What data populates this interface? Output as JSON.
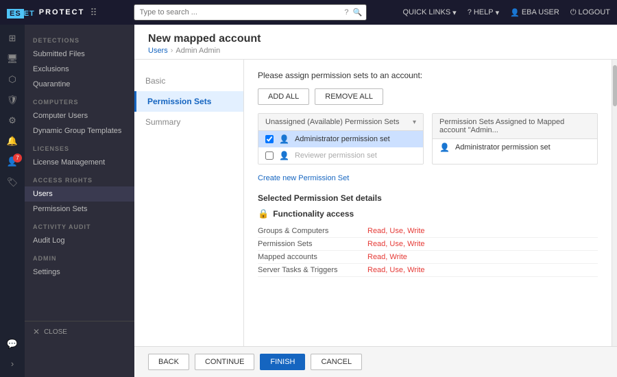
{
  "topbar": {
    "logo": "ESET",
    "product": "PROTECT",
    "search_placeholder": "Type to search ...",
    "quick_links": "QUICK LINKS",
    "help": "HELP",
    "user": "EBA USER",
    "logout": "LOGOUT"
  },
  "sidebar_icons": [
    {
      "name": "dashboard-icon",
      "symbol": "⊞",
      "active": false
    },
    {
      "name": "computers-icon",
      "symbol": "🖥",
      "active": false
    },
    {
      "name": "share-icon",
      "symbol": "⬡",
      "active": false
    },
    {
      "name": "shield-icon",
      "symbol": "🛡",
      "active": false
    },
    {
      "name": "gear-icon",
      "symbol": "⚙",
      "active": false
    },
    {
      "name": "bell-icon",
      "symbol": "🔔",
      "active": false
    },
    {
      "name": "users-icon",
      "symbol": "👤",
      "active": true,
      "badge": "7"
    },
    {
      "name": "tag-icon",
      "symbol": "🏷",
      "active": false
    },
    {
      "name": "more-icon",
      "symbol": "···",
      "active": false
    }
  ],
  "sidebar_nav": {
    "sections": [
      {
        "title": "DETECTIONS",
        "items": [
          {
            "label": "Submitted Files",
            "active": false
          },
          {
            "label": "Exclusions",
            "active": false
          },
          {
            "label": "Quarantine",
            "active": false
          }
        ]
      },
      {
        "title": "COMPUTERS",
        "items": [
          {
            "label": "Computer Users",
            "active": false
          },
          {
            "label": "Dynamic Group Templates",
            "active": false
          }
        ]
      },
      {
        "title": "LICENSES",
        "items": [
          {
            "label": "License Management",
            "active": false
          }
        ]
      },
      {
        "title": "ACCESS RIGHTS",
        "items": [
          {
            "label": "Users",
            "active": true
          },
          {
            "label": "Permission Sets",
            "active": false
          }
        ]
      },
      {
        "title": "ACTIVITY AUDIT",
        "items": [
          {
            "label": "Audit Log",
            "active": false
          }
        ]
      },
      {
        "title": "ADMIN",
        "items": [
          {
            "label": "Settings",
            "active": false
          }
        ]
      }
    ],
    "close_label": "CLOSE"
  },
  "page": {
    "title": "New mapped account",
    "breadcrumb": [
      "Users",
      "Admin Admin"
    ]
  },
  "wizard": {
    "tabs": [
      {
        "label": "Basic",
        "active": false
      },
      {
        "label": "Permission Sets",
        "active": true
      },
      {
        "label": "Summary",
        "active": false
      }
    ]
  },
  "permission_sets": {
    "section_title": "Please assign permission sets to an account:",
    "add_all_label": "ADD ALL",
    "remove_all_label": "REMOVE ALL",
    "available_panel": {
      "header": "Unassigned (Available) Permission Sets",
      "items": [
        {
          "label": "Administrator permission set",
          "checked": true,
          "selected": true
        },
        {
          "label": "Reviewer permission set",
          "checked": false,
          "selected": false
        }
      ]
    },
    "assigned_panel": {
      "header": "Permission Sets Assigned to Mapped account \"Admin...",
      "items": [
        {
          "label": "Administrator permission set"
        }
      ]
    },
    "create_link": "Create new Permission Set",
    "selected_details_title": "Selected Permission Set details",
    "func_access_label": "Functionality access",
    "detail_rows": [
      {
        "label": "Groups & Computers",
        "value": "Read, Use, Write"
      },
      {
        "label": "Permission Sets",
        "value": "Read, Use, Write"
      },
      {
        "label": "Mapped accounts",
        "value": "Read, Write"
      },
      {
        "label": "Server Tasks & Triggers",
        "value": "Read, Use, Write"
      }
    ]
  },
  "footer": {
    "back_label": "BACK",
    "continue_label": "CONTINUE",
    "finish_label": "FINISH",
    "cancel_label": "CANCEL"
  }
}
